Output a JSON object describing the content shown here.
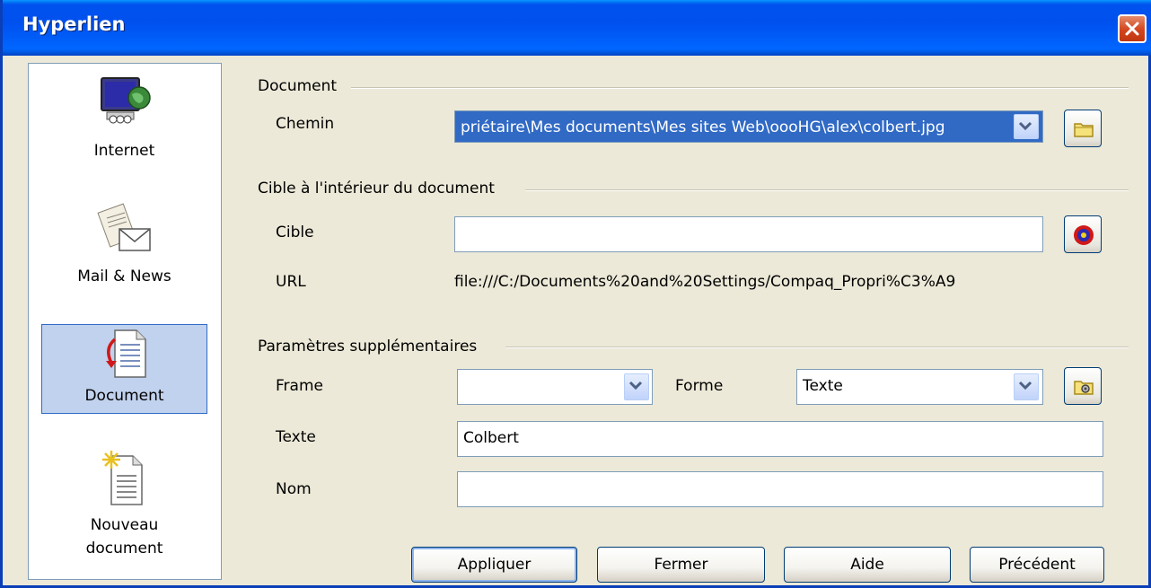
{
  "window": {
    "title": "Hyperlien"
  },
  "sidebar": {
    "items": [
      {
        "label": "Internet",
        "icon": "globe-monitor-icon"
      },
      {
        "label": "Mail & News",
        "icon": "mail-news-icon"
      },
      {
        "label": "Document",
        "icon": "document-icon",
        "selected": true
      },
      {
        "label": "Nouveau\ndocument",
        "label_line1": "Nouveau",
        "label_line2": "document",
        "icon": "new-document-icon"
      }
    ]
  },
  "document": {
    "group_title": "Document",
    "path_label": "Chemin",
    "path_value": "priétaire\\Mes documents\\Mes sites Web\\oooHG\\alex\\colbert.jpg"
  },
  "target": {
    "group_title": "Cible à l'intérieur du document",
    "target_label": "Cible",
    "target_value": "",
    "url_label": "URL",
    "url_value": "file:///C:/Documents%20and%20Settings/Compaq_Propri%C3%A9"
  },
  "extra": {
    "group_title": "Paramètres supplémentaires",
    "frame_label": "Frame",
    "frame_value": "",
    "form_label": "Forme",
    "form_value": "Texte",
    "text_label": "Texte",
    "text_value": "Colbert",
    "name_label": "Nom",
    "name_value": ""
  },
  "buttons": {
    "apply": "Appliquer",
    "close": "Fermer",
    "help": "Aide",
    "back": "Précédent"
  },
  "colors": {
    "titlebar": "#0054e3",
    "selection": "#316ac5",
    "close_button": "#d2451f"
  }
}
